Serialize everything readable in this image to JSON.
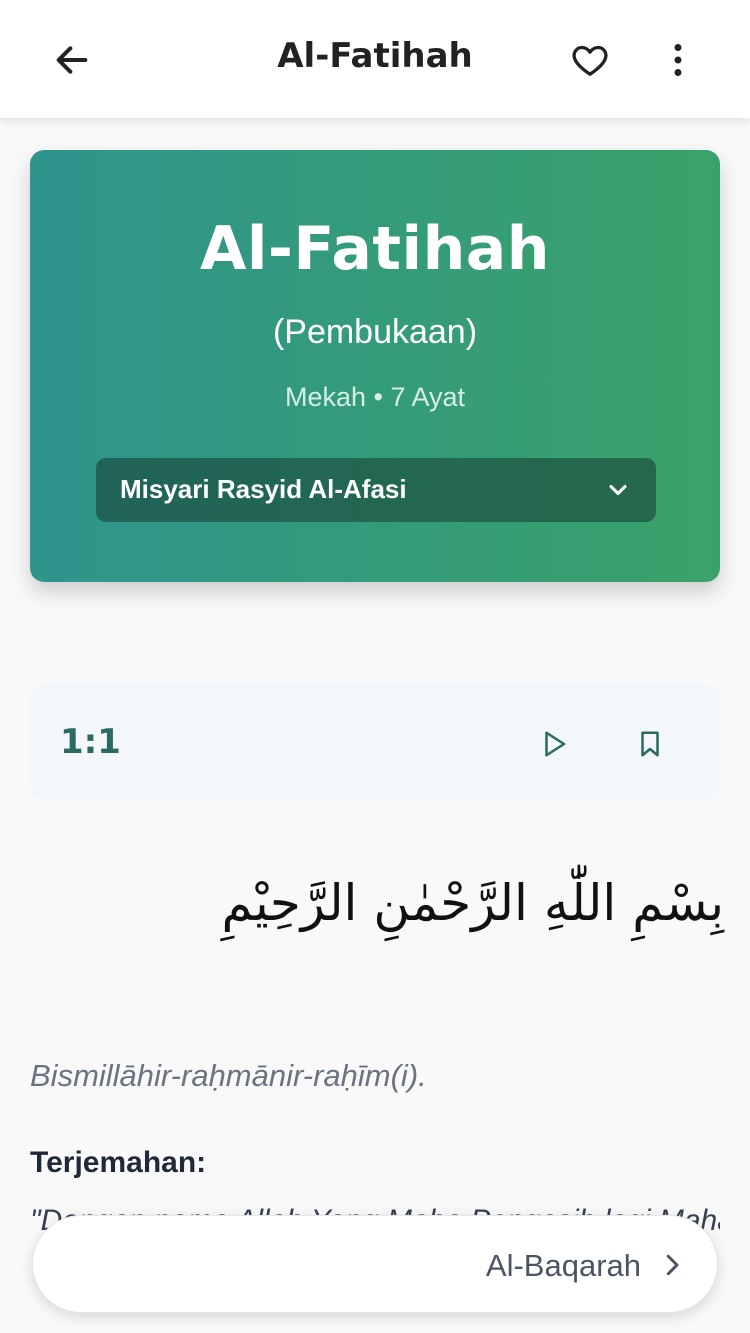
{
  "appbar": {
    "title": "Al-Fatihah",
    "back_icon": "arrow-left-icon",
    "favorite_icon": "heart-icon",
    "menu_icon": "more-vertical-icon"
  },
  "surah": {
    "name": "Al-Fatihah",
    "meaning": "(Pembukaan)",
    "meta": "Mekah • 7 Ayat",
    "reciter": "Misyari Rasyid Al-Afasi",
    "gradient": [
      "#2e948c",
      "#3aa269"
    ]
  },
  "verse": {
    "number": "1:1",
    "arabic": "بِسْمِ اللّٰهِ الرَّحْمٰنِ الرَّحِيْمِ",
    "latin": "Bismillāhir-raḥmānir-raḥīm(i).",
    "translation_label": "Terjemahan:",
    "translation": "\"Dengan nama Allah Yang Maha Pengasih lagi Maha Penyayang.\""
  },
  "next_surah": {
    "label": "Al-Baqarah",
    "icon": "chevron-right-icon"
  }
}
